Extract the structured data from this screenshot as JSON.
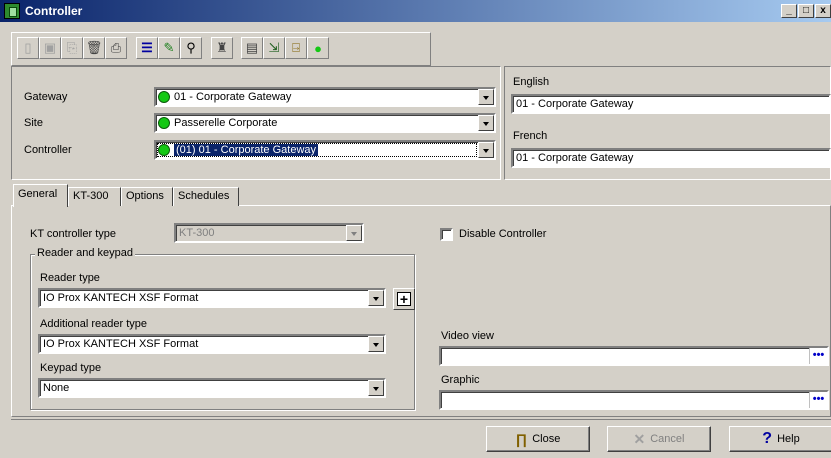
{
  "window": {
    "title": "Controller",
    "title_buttons": [
      "_",
      "□",
      "x"
    ]
  },
  "toolbar": {
    "icons": [
      "new-icon",
      "save-icon",
      "copy-icon",
      "delete-icon",
      "print-icon",
      "list-icon",
      "link-icon",
      "find-icon",
      "users-icon",
      "door-icon",
      "enter-icon",
      "exit-icon",
      "status-icon"
    ]
  },
  "selection": {
    "gateway_label": "Gateway",
    "gateway_value": "01 - Corporate Gateway",
    "site_label": "Site",
    "site_value": "Passerelle Corporate",
    "controller_label": "Controller",
    "controller_value": "(01) 01 - Corporate Gateway"
  },
  "names": {
    "english_label": "English",
    "english_value": "01 - Corporate Gateway",
    "french_label": "French",
    "french_value": "01 - Corporate Gateway"
  },
  "tabs": [
    {
      "label": "General",
      "active": true
    },
    {
      "label": "KT-300",
      "active": false
    },
    {
      "label": "Options",
      "active": false
    },
    {
      "label": "Schedules",
      "active": false
    }
  ],
  "general": {
    "kt_type_label": "KT controller type",
    "kt_type_value": "KT-300",
    "disable_label": "Disable Controller",
    "reader_group_label": "Reader and keypad",
    "reader_type_label": "Reader type",
    "reader_type_value": "IO Prox KANTECH XSF Format",
    "additional_reader_label": "Additional reader type",
    "additional_reader_value": "IO Prox KANTECH XSF Format",
    "keypad_type_label": "Keypad type",
    "keypad_type_value": "None",
    "video_view_label": "Video view",
    "video_view_value": "",
    "graphic_label": "Graphic",
    "graphic_value": "",
    "browse_glyph": "•••"
  },
  "buttons": {
    "close": "Close",
    "cancel": "Cancel",
    "help": "Help"
  }
}
